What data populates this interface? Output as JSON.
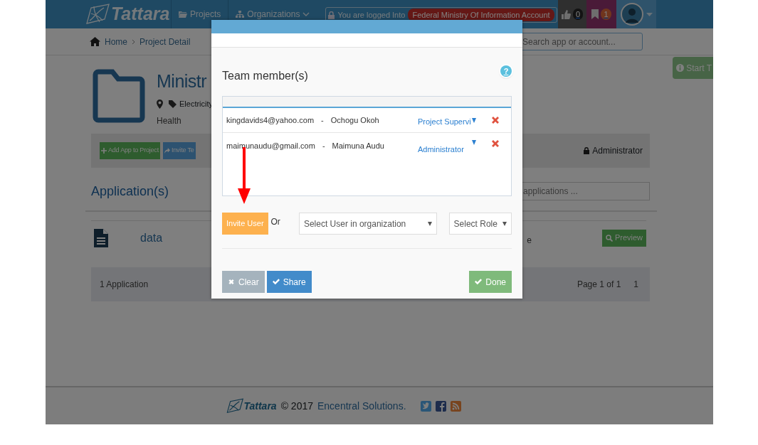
{
  "navbar": {
    "brand": "Tattara",
    "links": [
      {
        "label": "Projects",
        "kind": "folder",
        "dropdown": false
      },
      {
        "label": "Organizations",
        "kind": "sitemap",
        "dropdown": true
      }
    ],
    "login_notice": {
      "label": "You are logged Into",
      "account": "Federal Ministry Of Information Account"
    },
    "likes": {
      "count": "0"
    },
    "bookmarks": {
      "count": "1"
    }
  },
  "breadcrumb": [
    "Home",
    "Project Detail"
  ],
  "search": {
    "placeholder": "Search app or account..."
  },
  "tour_button": "Start T",
  "project": {
    "title": "Ministr",
    "tags": [
      "Electricity"
    ],
    "category": "Health"
  },
  "actions": [
    {
      "label": "Add App to Project",
      "kind": "add"
    },
    {
      "label": "Invite Te",
      "kind": "share"
    }
  ],
  "role": "Administrator",
  "applications": {
    "heading": "Application(s)",
    "search_placeholder": "applications ...",
    "rows": [
      {
        "name": "data",
        "column_3": "e",
        "action": "Preview"
      }
    ],
    "count": "1 Application",
    "pager": "Page 1 of 1",
    "page": "1"
  },
  "footer": {
    "brand": "Tattara",
    "copyright": "© 2017",
    "company": "Encentral Solutions."
  },
  "modal": {
    "title": "Team member(s)",
    "help": "?",
    "members": [
      {
        "email": "kingdavids4@yahoo.com",
        "separator": "-",
        "name": "Ochogu Okoh",
        "role": "Project Supervi"
      },
      {
        "email": "maimunaudu@gmail.com",
        "separator": "-",
        "name": "Maimuna Audu",
        "role": "Administrator"
      }
    ],
    "invite_button": "Invite User",
    "or": "Or",
    "user_select": {
      "placeholder": "Select User in organization"
    },
    "role_select": {
      "placeholder": "Select Role"
    },
    "buttons": [
      {
        "label": "Clear",
        "kind": "clear"
      },
      {
        "label": "Share",
        "kind": "share"
      },
      {
        "label": "Done",
        "kind": "done"
      }
    ]
  }
}
